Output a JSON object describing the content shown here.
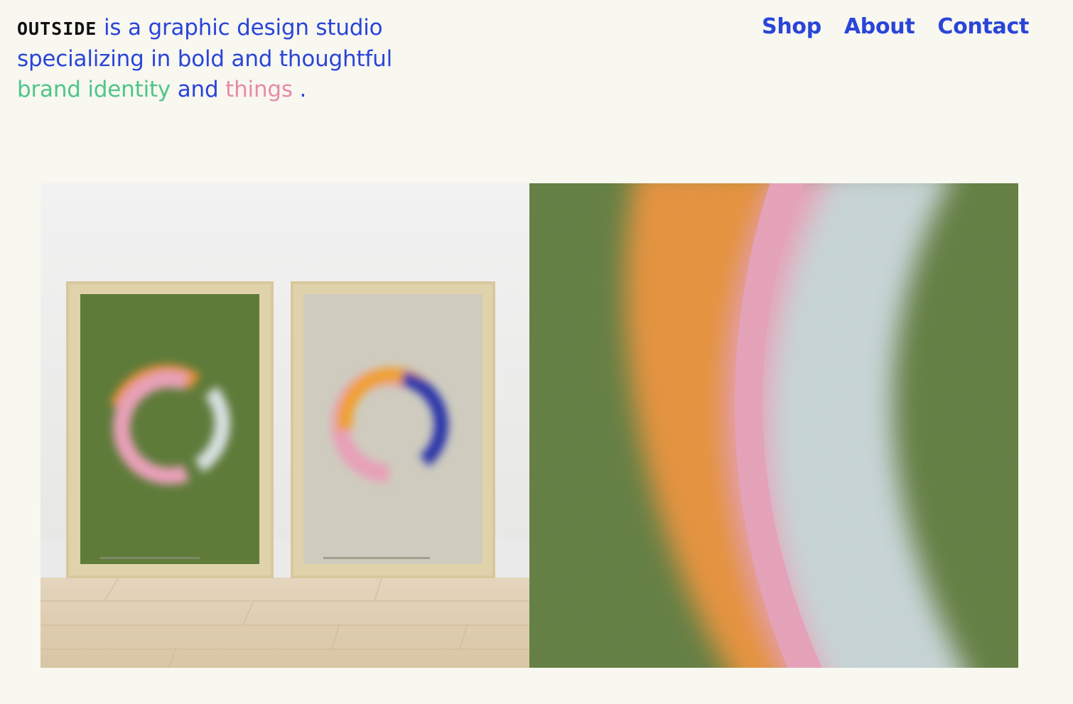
{
  "header": {
    "logo": "OUTSIDE",
    "tagline_1": "is a graphic design studio specializing in bold and thoughtful",
    "highlight_1": "brand identity",
    "connector": "and",
    "highlight_2": "things",
    "period": "."
  },
  "nav": {
    "items": [
      {
        "label": "Shop"
      },
      {
        "label": "About"
      },
      {
        "label": "Contact"
      }
    ]
  },
  "gallery": {
    "images": [
      {
        "alt": "framed-posters-mockup"
      },
      {
        "alt": "poster-detail-closeup"
      }
    ]
  },
  "colors": {
    "background": "#f8f7f0",
    "blue": "#2a45d8",
    "green": "#4fc58a",
    "pink": "#e88aa8",
    "poster_green": "#5d7a3a",
    "orange": "#e89035",
    "light_pink": "#e8a0b8",
    "pale_blue": "#c8d6d8",
    "navy": "#2b36a8"
  }
}
